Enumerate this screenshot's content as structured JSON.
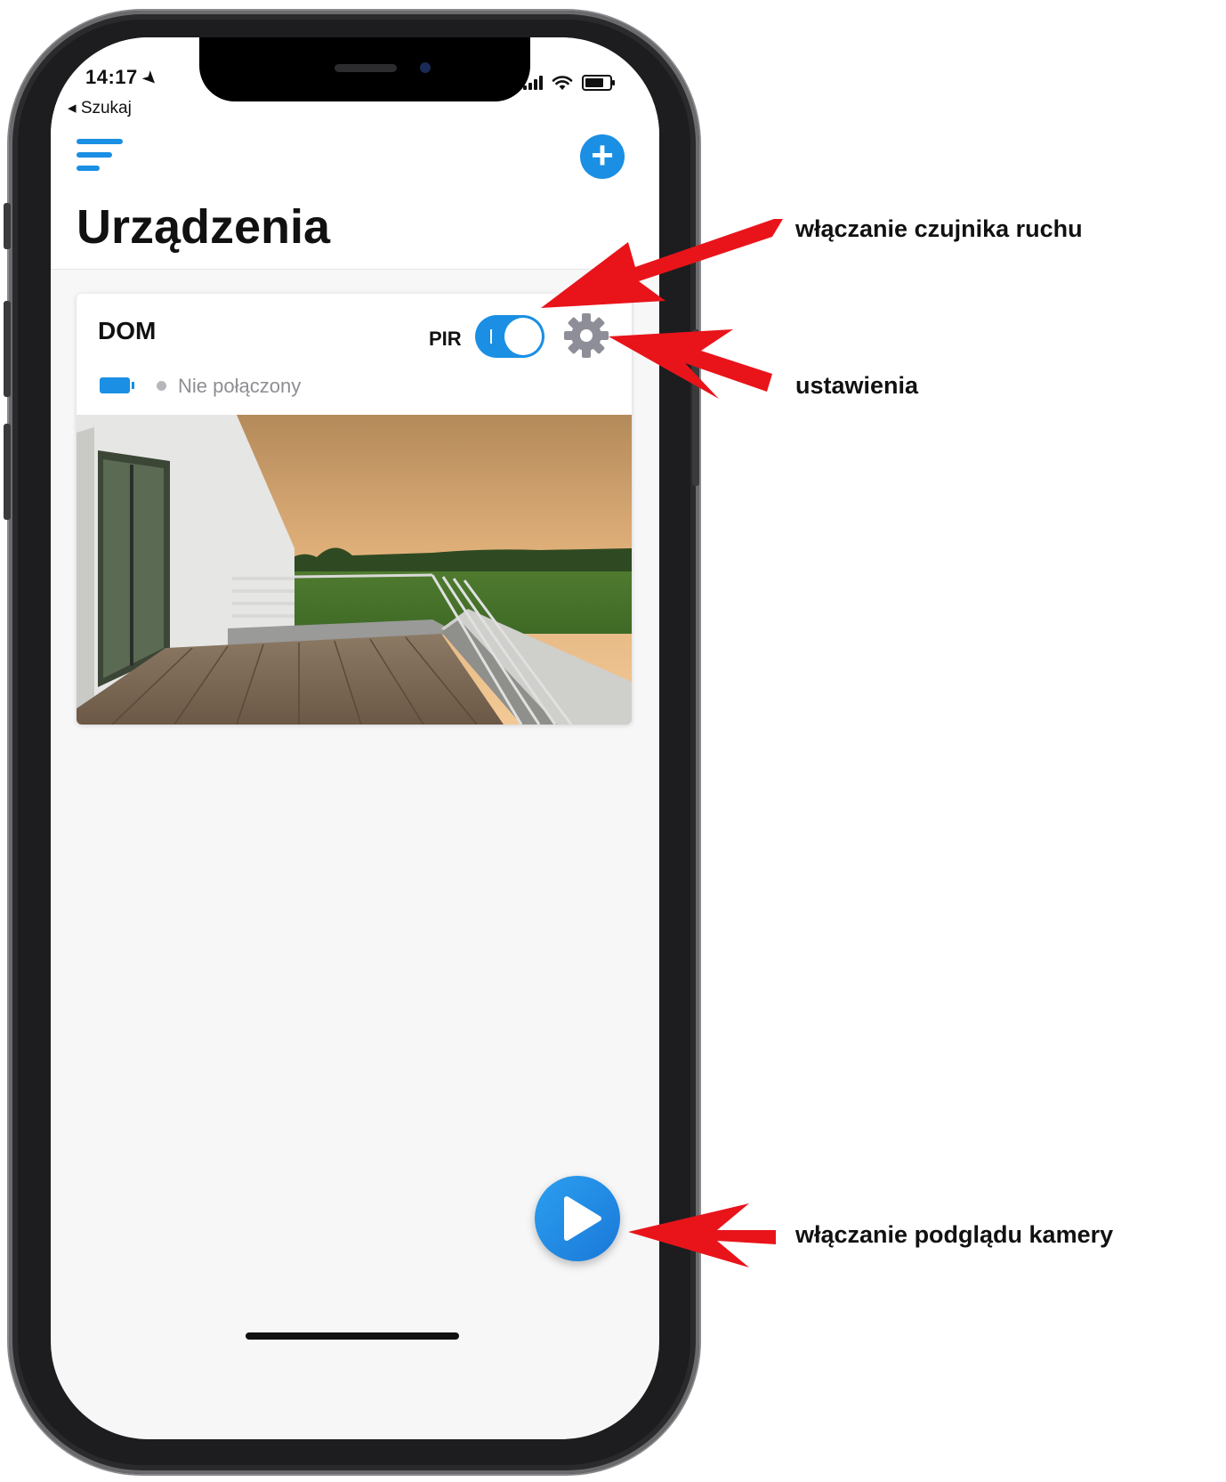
{
  "status_bar": {
    "time": "14:17",
    "location_icon": "location-arrow-icon",
    "back_label": "◂ Szukaj",
    "icons": [
      "signal-icon",
      "wifi-icon",
      "battery-icon"
    ]
  },
  "header": {
    "menu_icon": "menu-icon",
    "add_icon": "plus-circle-icon",
    "add_symbol": "+",
    "title": "Urządzenia"
  },
  "device": {
    "name": "DOM",
    "pir_label": "PIR",
    "pir_enabled": true,
    "settings_icon": "gear-icon",
    "battery_icon": "battery-icon",
    "status": "Nie połączony",
    "preview_image": "camera-preview-terrace"
  },
  "play_button": {
    "icon": "play-icon"
  },
  "annotations": {
    "motion_sensor": "włączanie czujnika ruchu",
    "settings": "ustawienia",
    "camera_preview": "włączanie podglądu kamery"
  },
  "colors": {
    "accent": "#1a8fe3",
    "annotation_arrow": "#e8141a",
    "status_gray": "#8e8e93"
  }
}
